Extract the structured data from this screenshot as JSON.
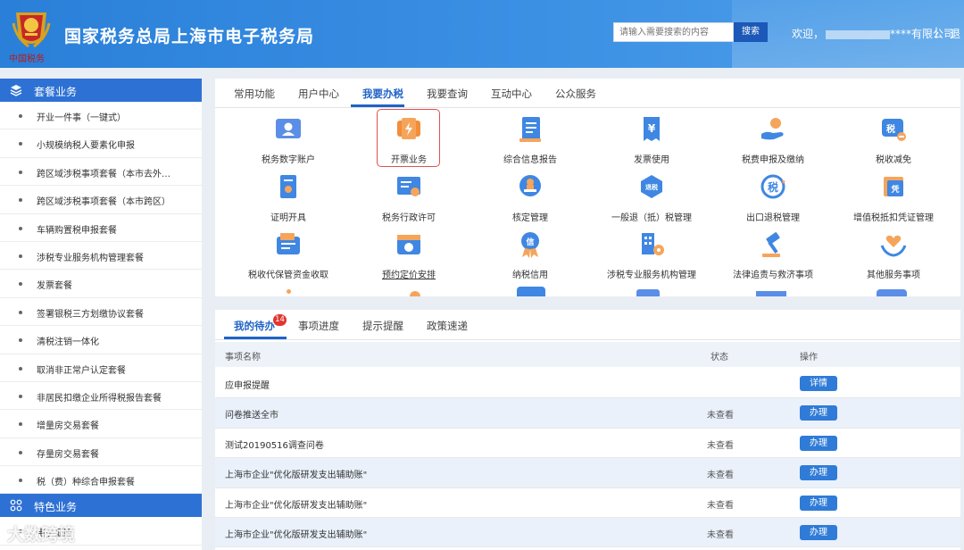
{
  "header": {
    "title": "国家税务总局上海市电子税务局",
    "emblem_caption": "中国税务",
    "search": {
      "placeholder": "请输入需要搜索的内容",
      "button": "搜索"
    },
    "welcome": "欢迎，",
    "company_suffix": "****有限公司",
    "separator": "|",
    "logout": "退"
  },
  "sidebar": {
    "section1": "套餐业务",
    "items": [
      "开业一件事（一键式）",
      "小规模纳税人要素化申报",
      "跨区域涉税事项套餐（本市去外…",
      "跨区域涉税事项套餐（本市跨区）",
      "车辆购置税申报套餐",
      "涉税专业服务机构管理套餐",
      "发票套餐",
      "签署银税三方划缴协议套餐",
      "清税注销一体化",
      "取消非正常户认定套餐",
      "非居民扣缴企业所得税报告套餐",
      "增量房交易套餐",
      "存量房交易套餐",
      "税（费）种综合申报套餐"
    ],
    "section2": "特色业务",
    "items2": [
      "电子证照"
    ]
  },
  "top_tabs": [
    "常用功能",
    "用户中心",
    "我要办税",
    "我要查询",
    "互动中心",
    "公众服务"
  ],
  "services": [
    "税务数字账户",
    "开票业务",
    "综合信息报告",
    "发票使用",
    "税费申报及缴纳",
    "税收减免",
    "证明开具",
    "税务行政许可",
    "核定管理",
    "一般退（抵）税管理",
    "出口退税管理",
    "增值税抵扣凭证管理",
    "税收代保管资金收取",
    "预约定价安排",
    "纳税信用",
    "涉税专业服务机构管理",
    "法律追责与救济事项",
    "其他服务事项"
  ],
  "icon_text": {
    "tui": "退税",
    "shui": "税",
    "ping": "凭",
    "xin": "信",
    "shuiyuan": "税",
    "yen": "¥"
  },
  "todo": {
    "tabs": [
      "我的待办",
      "事项进度",
      "提示提醒",
      "政策速递"
    ],
    "badge": "14",
    "columns": {
      "name": "事项名称",
      "status": "状态",
      "action": "操作"
    },
    "rows": [
      {
        "name": "应申报提醒",
        "status": "",
        "action": "详情"
      },
      {
        "name": "问卷推送全市",
        "status": "未查看",
        "action": "办理"
      },
      {
        "name": "测试20190516调查问卷",
        "status": "未查看",
        "action": "办理"
      },
      {
        "name": "上海市企业\"优化版研发支出辅助账\"",
        "status": "未查看",
        "action": "办理"
      },
      {
        "name": "上海市企业\"优化版研发支出辅助账\"",
        "status": "未查看",
        "action": "办理"
      },
      {
        "name": "上海市企业\"优化版研发支出辅助账\"",
        "status": "未查看",
        "action": "办理"
      }
    ]
  },
  "watermark": "大数跨境",
  "colors": {
    "header": "#2a7fd8",
    "accent": "#1f63c6",
    "button": "#2f7bd7",
    "badge": "#e0362f",
    "highlight": "#e05050"
  }
}
